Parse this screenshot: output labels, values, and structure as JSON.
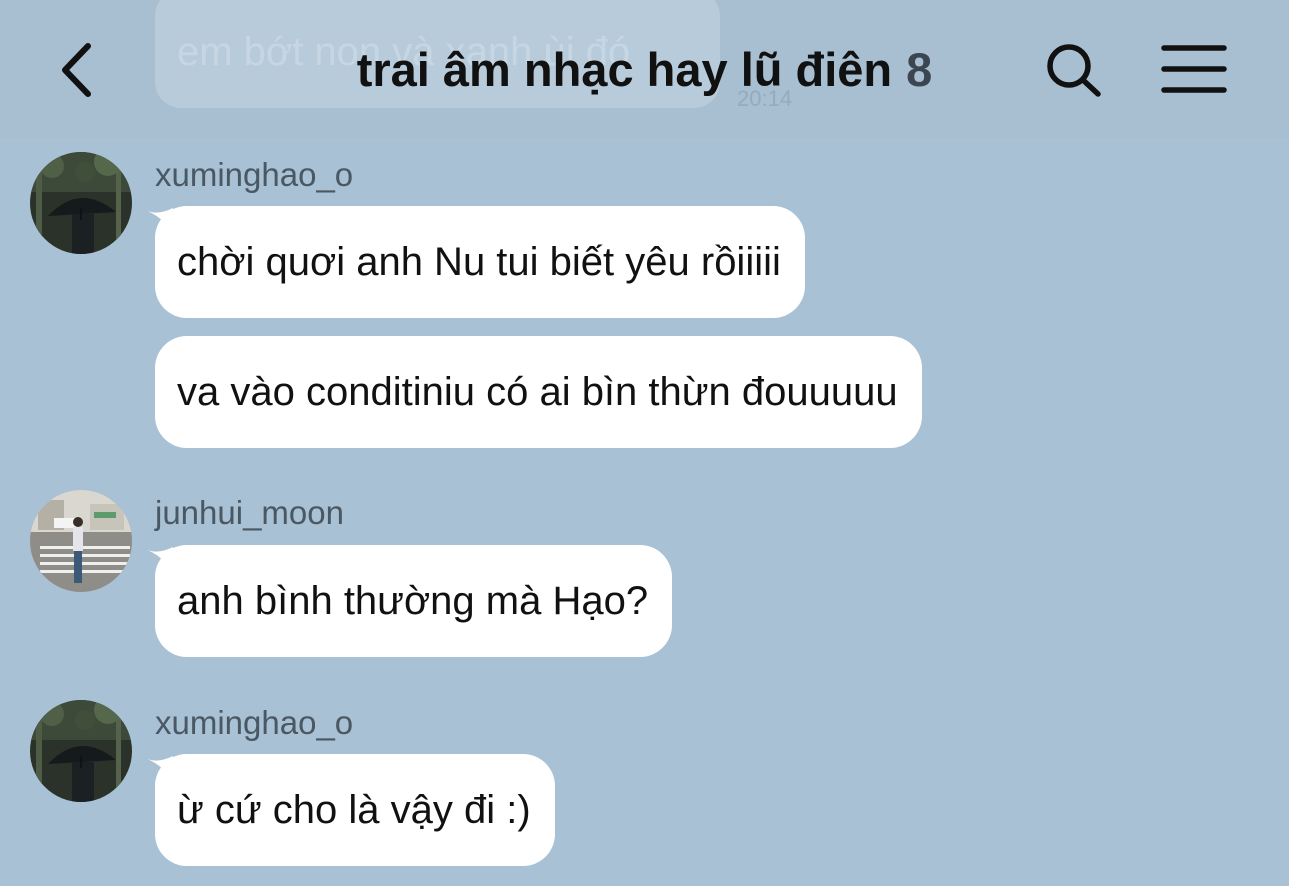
{
  "header": {
    "title": "trai âm nhạc hay lũ điên",
    "member_count": "8",
    "back_icon": "chevron-left-icon",
    "search_icon": "search-icon",
    "menu_icon": "hamburger-menu-icon"
  },
  "previous_message": {
    "text": "em bớt non và xanh ùi đó",
    "time": "20:14"
  },
  "messages": [
    {
      "sender": "xuminghao_o",
      "avatar": "avatar-umbrella-photo",
      "bubbles": [
        "chời quơi anh Nu tui biết yêu rồiiiii",
        "va vào conditiniu có ai bìn thừn đouuuuu"
      ]
    },
    {
      "sender": "junhui_moon",
      "avatar": "avatar-street-photo",
      "bubbles": [
        "anh bình thường mà Hạo?"
      ]
    },
    {
      "sender": "xuminghao_o",
      "avatar": "avatar-umbrella-photo",
      "bubbles": [
        "ừ cứ cho là vậy đi :)"
      ]
    }
  ],
  "colors": {
    "background": "#a9c1d4",
    "bubble": "#ffffff",
    "text": "#111111",
    "sender_name": "#4a5864"
  }
}
